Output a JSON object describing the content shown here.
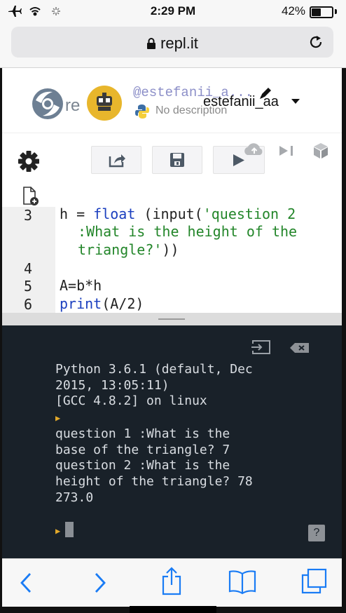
{
  "status_bar": {
    "time": "2:29 PM",
    "battery_pct": "42%",
    "battery_level": 0.42
  },
  "browser": {
    "url": "repl.it"
  },
  "header": {
    "logo_text": "re",
    "username": "@estefanii_a...",
    "display_name": "estefanii_aa",
    "description": "No description"
  },
  "editor": {
    "lines": [
      {
        "num": "3"
      },
      {
        "num": "4"
      },
      {
        "num": "5"
      },
      {
        "num": "6"
      }
    ],
    "code": {
      "l3_var": "h = ",
      "l3_func": "float",
      "l3_mid": " (input(",
      "l3_str1": "'question 2",
      "l3_str2": ":What is the height of the",
      "l3_str3": "triangle?'",
      "l3_end": "))",
      "l5": "A=b*h",
      "l6_func": "print",
      "l6_rest": "(A/2)"
    }
  },
  "console": {
    "lines": [
      "Python 3.6.1 (default, Dec",
      "2015, 13:05:11)",
      "[GCC 4.8.2] on linux",
      "question 1 :What is the",
      "base of the triangle? 7",
      "question 2 :What is the",
      "height of the triangle? 78",
      "273.0"
    ],
    "help_label": "?"
  },
  "colors": {
    "console_bg": "#192129",
    "prompt": "#e3a92a",
    "ios_blue": "#1a7cf5"
  }
}
